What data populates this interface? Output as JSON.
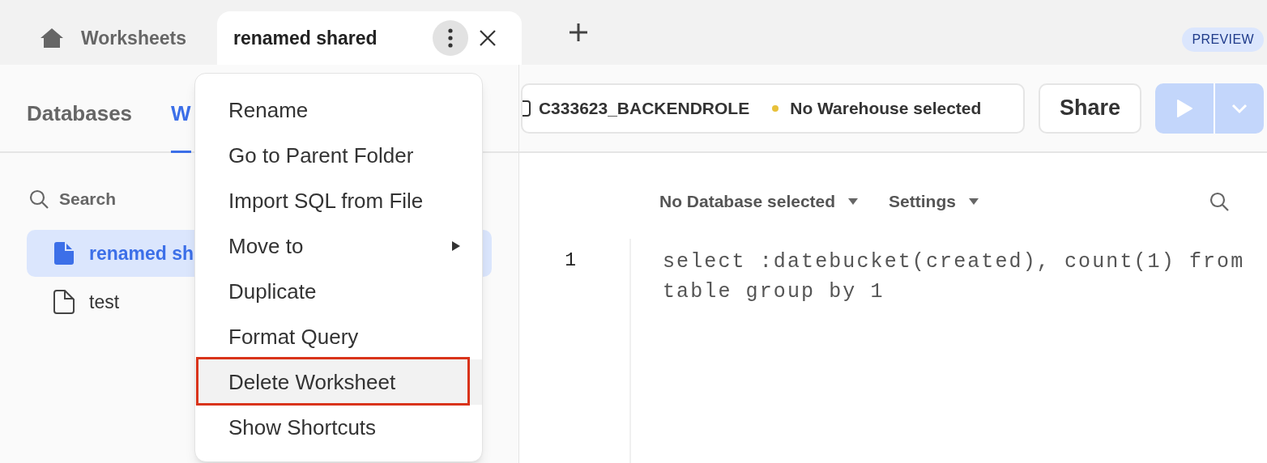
{
  "tabs": [
    {
      "kind": "home",
      "label": "Worksheets",
      "selected": false
    },
    {
      "kind": "worksheet",
      "label": "renamed shared",
      "selected": true
    }
  ],
  "badge": "PREVIEW",
  "sidebar": {
    "tabs": [
      {
        "label": "Databases",
        "selected": false
      },
      {
        "label": "W",
        "selected": true
      }
    ],
    "search": {
      "placeholder": "Search"
    },
    "items": [
      {
        "label": "renamed sh",
        "selected": true
      },
      {
        "label": "test",
        "selected": false
      }
    ]
  },
  "toolbar": {
    "role": "C333623_BACKENDROLE",
    "warehouse": {
      "label": "No Warehouse selected",
      "color": "#e8c13a"
    },
    "share": "Share"
  },
  "editor": {
    "database": "No Database selected",
    "settings": "Settings",
    "lines": [
      {
        "number": "1",
        "code": "select :datebucket(created), count(1) from table group by 1"
      }
    ]
  },
  "menu": [
    {
      "kind": "item",
      "label": "Rename",
      "selected": false,
      "annotated": false
    },
    {
      "kind": "item",
      "label": "Go to Parent Folder",
      "selected": false,
      "annotated": false
    },
    {
      "kind": "item",
      "label": "Import SQL from File",
      "selected": false,
      "annotated": false
    },
    {
      "kind": "submenu",
      "label": "Move to",
      "selected": false,
      "annotated": false
    },
    {
      "kind": "item",
      "label": "Duplicate",
      "selected": false,
      "annotated": false
    },
    {
      "kind": "item",
      "label": "Format Query",
      "selected": false,
      "annotated": false
    },
    {
      "kind": "item",
      "label": "Delete Worksheet",
      "selected": true,
      "annotated": true
    },
    {
      "kind": "item",
      "label": "Show Shortcuts",
      "selected": false,
      "annotated": false
    }
  ]
}
